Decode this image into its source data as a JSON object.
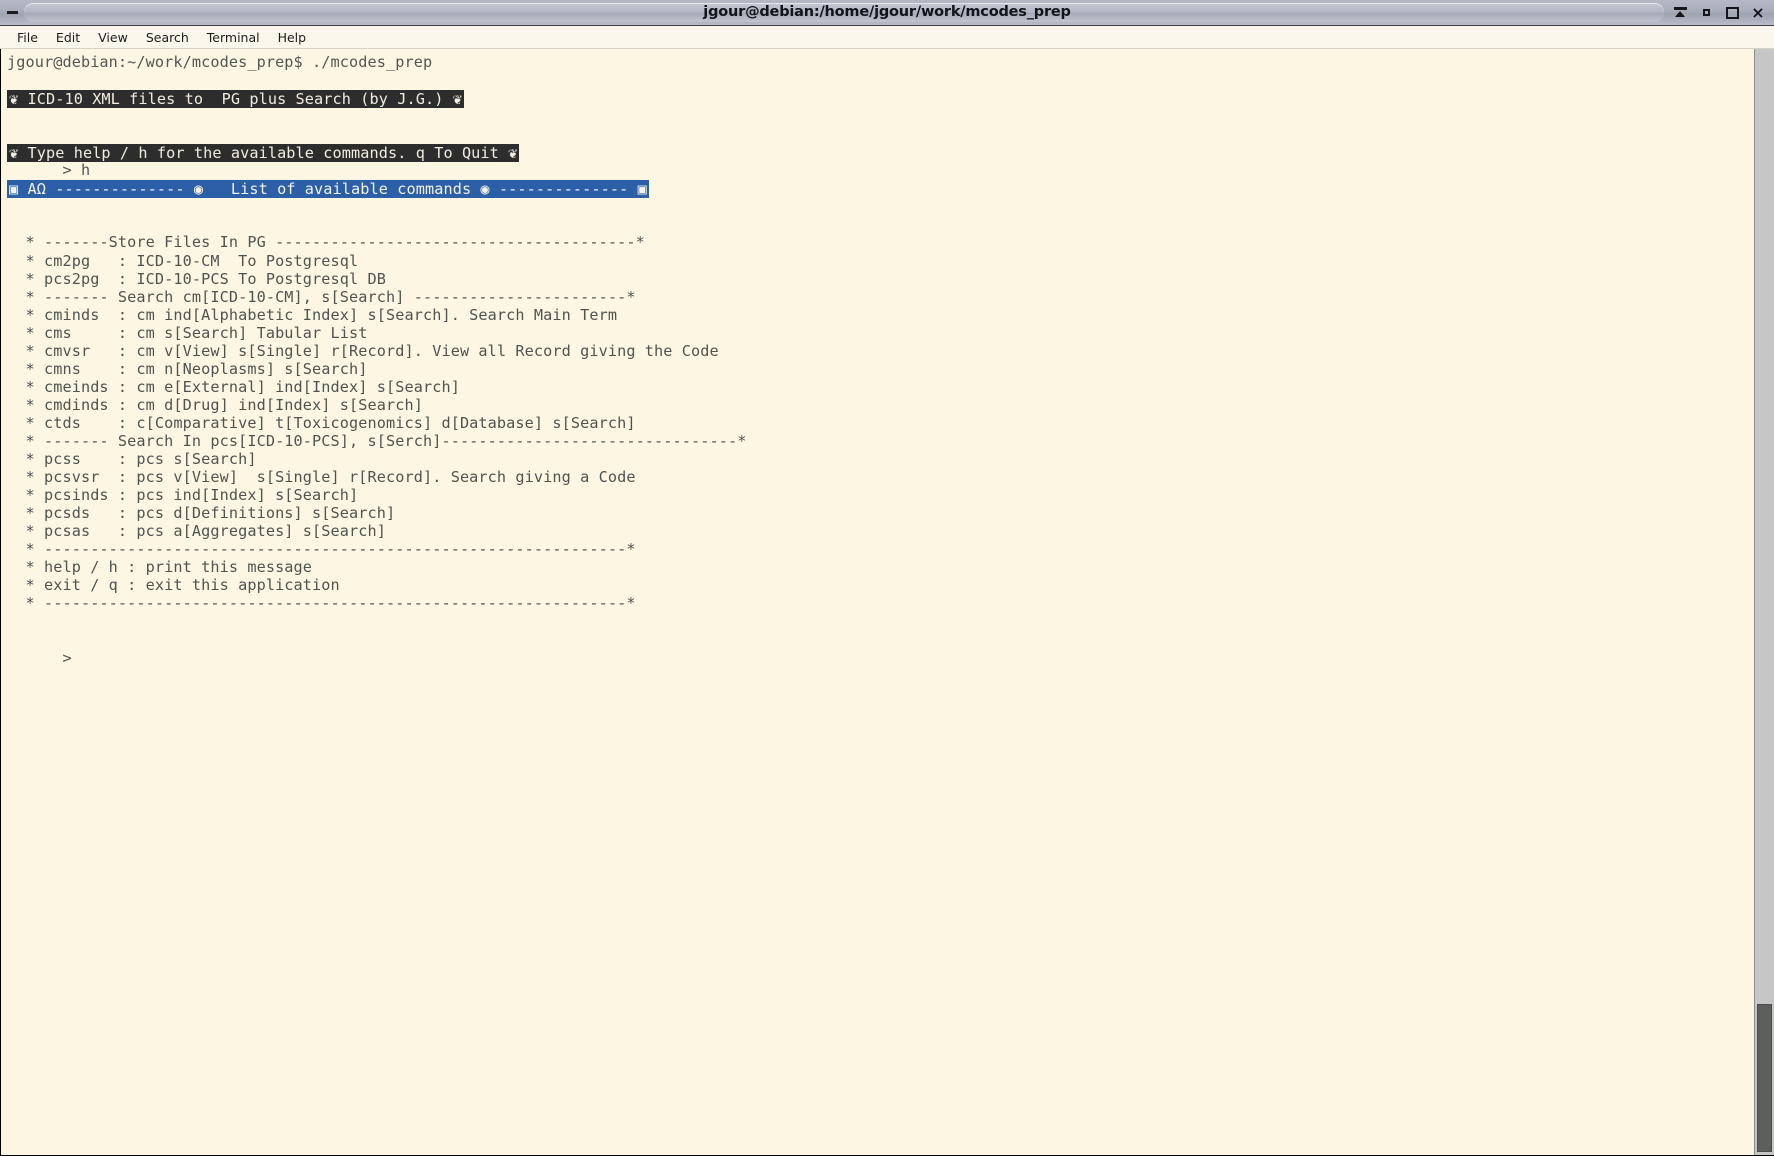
{
  "window": {
    "title": "jgour@debian:/home/jgour/work/mcodes_prep",
    "minimize_dash": "–",
    "controls": [
      {
        "name": "shade-button",
        "label": "shade"
      },
      {
        "name": "minimize-button",
        "label": "minimize"
      },
      {
        "name": "maximize-button",
        "label": "maximize"
      },
      {
        "name": "close-button",
        "label": "×"
      }
    ]
  },
  "menubar": {
    "items": [
      {
        "label": "File"
      },
      {
        "label": "Edit"
      },
      {
        "label": "View"
      },
      {
        "label": "Search"
      },
      {
        "label": "Terminal"
      },
      {
        "label": "Help"
      }
    ]
  },
  "terminal": {
    "prompt_line": "jgour@debian:~/work/mcodes_prep$ ./mcodes_prep",
    "banner1": "❦ ICD-10 XML files to  PG plus Search (by J.G.) ❦",
    "banner2": "❦ Type help / h for the available commands. q To Quit ❦",
    "input_line": "      > h",
    "header_bar": "▣ ΑΩ -------------- ◉   List of available commands ◉ -------------- ▣",
    "help_lines": [
      "  * -------Store Files In PG ---------------------------------------*",
      "  * cm2pg   : ICD-10-CM  To Postgresql",
      "  * pcs2pg  : ICD-10-PCS To Postgresql DB",
      "  * ------- Search cm[ICD-10-CM], s[Search] -----------------------*",
      "  * cminds  : cm ind[Alphabetic Index] s[Search]. Search Main Term",
      "  * cms     : cm s[Search] Tabular List",
      "  * cmvsr   : cm v[View] s[Single] r[Record]. View all Record giving the Code",
      "  * cmns    : cm n[Neoplasms] s[Search]",
      "  * cmeinds : cm e[External] ind[Index] s[Search]",
      "  * cmdinds : cm d[Drug] ind[Index] s[Search]",
      "  * ctds    : c[Comparative] t[Toxicogenomics] d[Database] s[Search]",
      "  * ------- Search In pcs[ICD-10-PCS], s[Serch]--------------------------------*",
      "  * pcss    : pcs s[Search]",
      "  * pcsvsr  : pcs v[View]  s[Single] r[Record]. Search giving a Code",
      "  * pcsinds : pcs ind[Index] s[Search]",
      "  * pcsds   : pcs d[Definitions] s[Search]",
      "  * pcsas   : pcs a[Aggregates] s[Search]",
      "  * ---------------------------------------------------------------*",
      "  * help / h : print this message",
      "  * exit / q : exit this application",
      "  * ---------------------------------------------------------------*"
    ],
    "final_prompt": "      >"
  },
  "colors": {
    "terminal_background": "#fdf6e3",
    "terminal_text": "#4f5451",
    "banner_background": "#2d2d2d",
    "banner_text": "#f2ede0",
    "header_bar_background": "#2b5fa8",
    "header_bar_text": "#f5f2e8",
    "titlebar": "#aaaeba",
    "scrollbar_thumb": "#5d5f5d"
  }
}
